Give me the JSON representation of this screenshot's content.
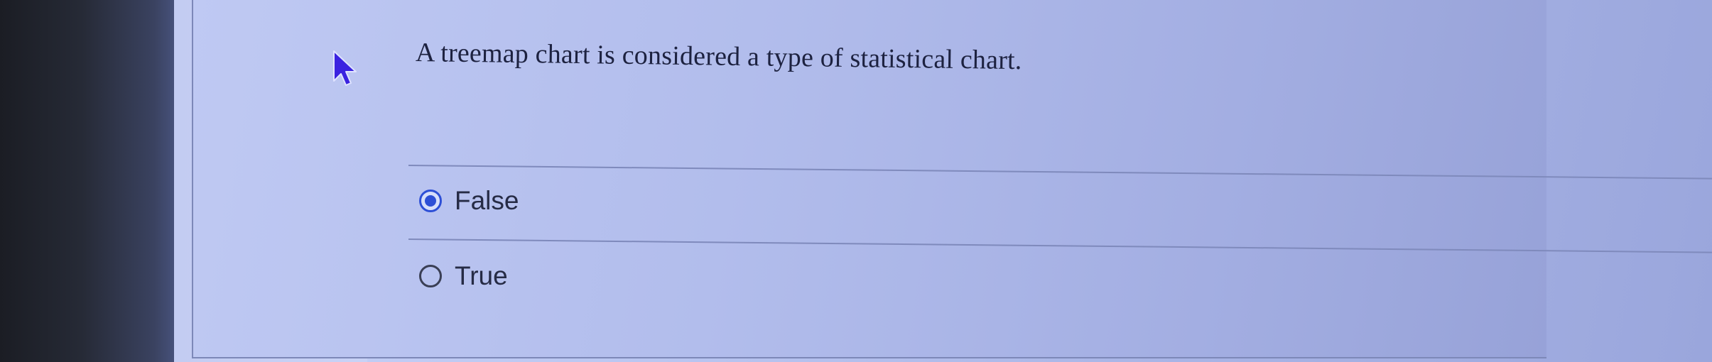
{
  "question": {
    "text": "A treemap chart is considered a type of statistical chart."
  },
  "options": [
    {
      "label": "False",
      "selected": true
    },
    {
      "label": "True",
      "selected": false
    }
  ],
  "colors": {
    "radio_selected": "#2d4fd6",
    "text": "#262b45",
    "cursor": "#3a22e0"
  }
}
